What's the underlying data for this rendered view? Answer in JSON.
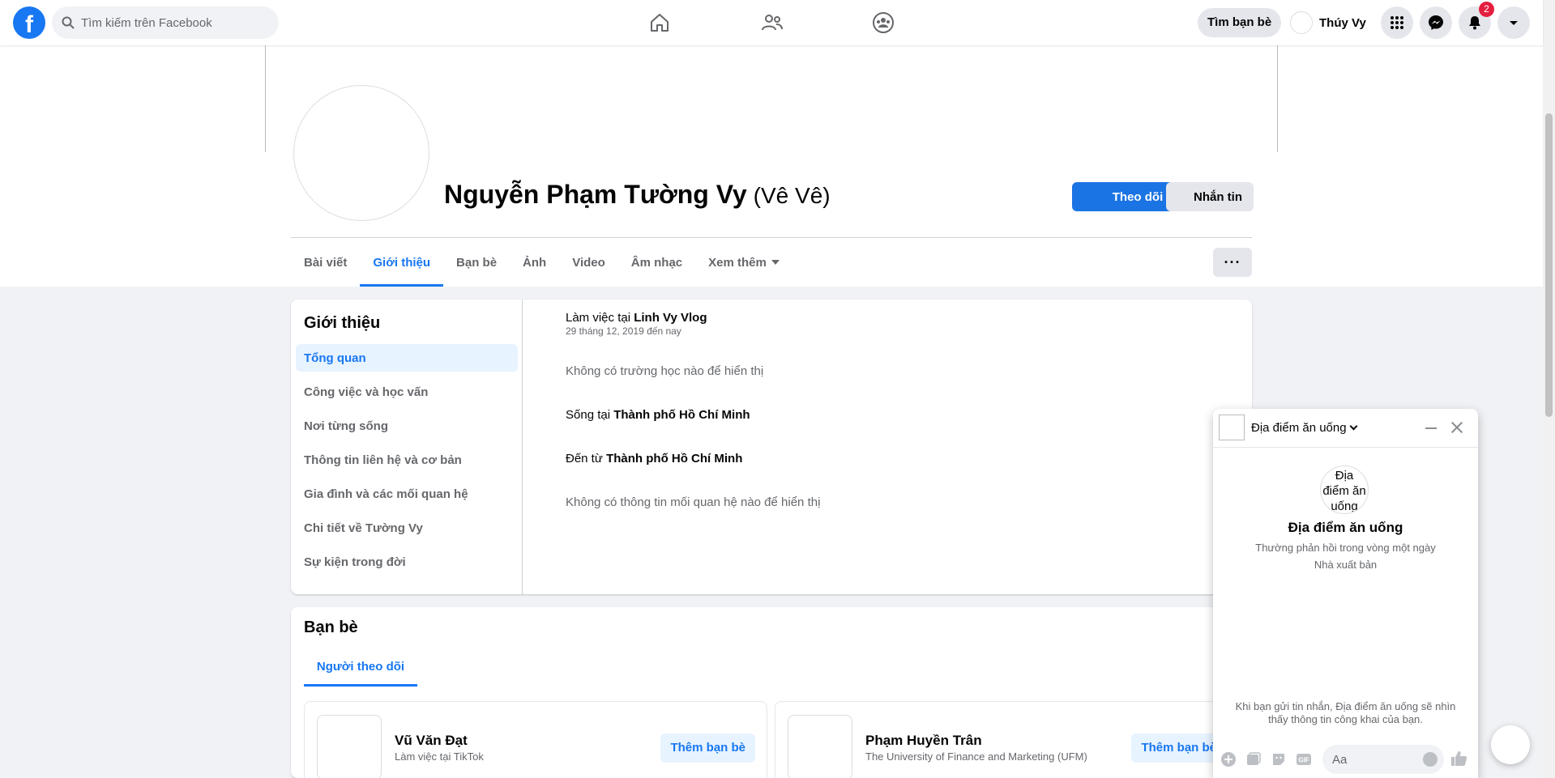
{
  "nav": {
    "search_placeholder": "Tìm kiếm trên Facebook",
    "find_friends_label": "Tìm bạn bè",
    "me_name": "Thúy Vy",
    "notification_count": "2",
    "icons": [
      "facebook-logo",
      "home-icon",
      "friends-icon",
      "groups-icon",
      "menu-grid-icon",
      "messenger-icon",
      "bell-icon",
      "account-caret-icon"
    ]
  },
  "profile": {
    "name": "Nguyễn Phạm Tường Vy",
    "nickname": "(Vê Vê)",
    "follow_label": "Theo dõi",
    "message_label": "Nhắn tin",
    "more_label": "···",
    "tabs": [
      {
        "label": "Bài viết",
        "active": false
      },
      {
        "label": "Giới thiệu",
        "active": true
      },
      {
        "label": "Bạn bè",
        "active": false
      },
      {
        "label": "Ảnh",
        "active": false
      },
      {
        "label": "Video",
        "active": false
      },
      {
        "label": "Âm nhạc",
        "active": false
      },
      {
        "label": "Xem thêm",
        "active": false
      }
    ]
  },
  "about": {
    "title": "Giới thiệu",
    "menu": [
      "Tổng quan",
      "Công việc và học vấn",
      "Nơi từng sống",
      "Thông tin liên hệ và cơ bản",
      "Gia đình và các mối quan hệ",
      "Chi tiết về Tường Vy",
      "Sự kiện trong đời"
    ],
    "work_prefix": "Làm việc tại",
    "work_place": "Linh Vy Vlog",
    "work_date": "29 tháng 12, 2019 đến nay",
    "no_school": "Không có trường học nào để hiển thị",
    "lives_prefix": "Sống tại",
    "lives_place": "Thành phố Hồ Chí Minh",
    "from_prefix": "Đến từ",
    "from_place": "Thành phố Hồ Chí Minh",
    "no_relationship": "Không có thông tin mối quan hệ nào để hiển thị"
  },
  "friends": {
    "title": "Bạn bè",
    "tab_label": "Người theo dõi",
    "items": [
      {
        "name": "Vũ Văn Đạt",
        "sub": "Làm việc tại TikTok",
        "action": "Thêm bạn bè"
      },
      {
        "name": "Phạm Huyền Trân",
        "sub": "The University of Finance and Marketing (UFM)",
        "action": "Thêm bạn bè"
      }
    ]
  },
  "chat": {
    "page_name": "Địa điểm ăn uống",
    "avatar_alt": "Địa điểm ăn uống",
    "response_time": "Thường phản hồi trong vòng một ngày",
    "role": "Nhà xuất bản",
    "notice": "Khi bạn gửi tin nhắn, Địa điểm ăn uống sẽ nhìn thấy thông tin công khai của bạn.",
    "input_placeholder": "Aa",
    "gif_label": "GIF"
  },
  "colors": {
    "brand": "#1877f2",
    "badge": "#e41e3f",
    "light_blue": "#e7f3ff"
  }
}
